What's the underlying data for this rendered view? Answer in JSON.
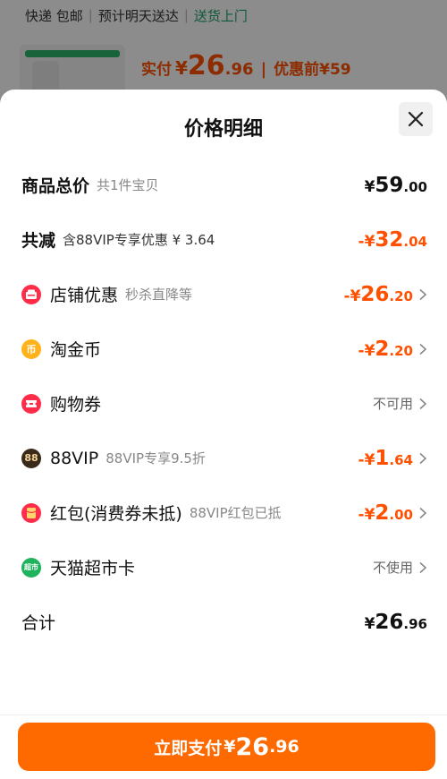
{
  "background": {
    "shipping": {
      "express": "快递 包邮",
      "eta": "预计明天送达",
      "delivery": "送货上门"
    },
    "price": {
      "label": "实付",
      "currency": "¥",
      "integer": "26",
      "decimal": ".96",
      "before_label": "优惠前",
      "before_value": "¥59"
    }
  },
  "sheet": {
    "title": "价格明细",
    "rows": [
      {
        "name": "商品总价",
        "sub": "共1件宝贝",
        "amount": {
          "currency": "¥",
          "integer": "59",
          "decimal": ".00"
        }
      },
      {
        "name": "共减",
        "sub": "含88VIP专享优惠 ¥ 3.64",
        "amount": {
          "currency": "-¥",
          "integer": "32",
          "decimal": ".04"
        }
      },
      {
        "name": "店铺优惠",
        "sub": "秒杀直降等",
        "amount": {
          "currency": "-¥",
          "integer": "26",
          "decimal": ".20"
        }
      },
      {
        "name": "淘金币",
        "sub": "",
        "amount": {
          "currency": "-¥",
          "integer": "2",
          "decimal": ".20"
        }
      },
      {
        "name": "购物券",
        "sub": "",
        "status": "不可用"
      },
      {
        "name": "88VIP",
        "sub": "88VIP专享9.5折",
        "amount": {
          "currency": "-¥",
          "integer": "1",
          "decimal": ".64"
        }
      },
      {
        "name": "红包(消费券未抵)",
        "sub": "88VIP红包已抵",
        "amount": {
          "currency": "-¥",
          "integer": "2",
          "decimal": ".00"
        }
      },
      {
        "name": "天猫超市卡",
        "sub": "",
        "status": "不使用"
      },
      {
        "name": "合计",
        "sub": "",
        "amount": {
          "currency": "¥",
          "integer": "26",
          "decimal": ".96"
        }
      }
    ],
    "icons": {
      "shop": "shop-discount-icon",
      "coin": "taojinbi-coin-icon",
      "voucher": "voucher-icon",
      "vip": "88vip-icon",
      "redpacket": "red-packet-icon",
      "supermarket": "tmall-supermarket-card-icon",
      "vip_text": "88",
      "coin_text": "币",
      "supermarket_text": "超市"
    }
  },
  "footer": {
    "pay_label": "立即支付",
    "currency": "¥",
    "integer": "26",
    "decimal": ".96"
  },
  "colors": {
    "accent": "#ff5000",
    "button": "#ff6a00",
    "green": "#1aa36b"
  }
}
